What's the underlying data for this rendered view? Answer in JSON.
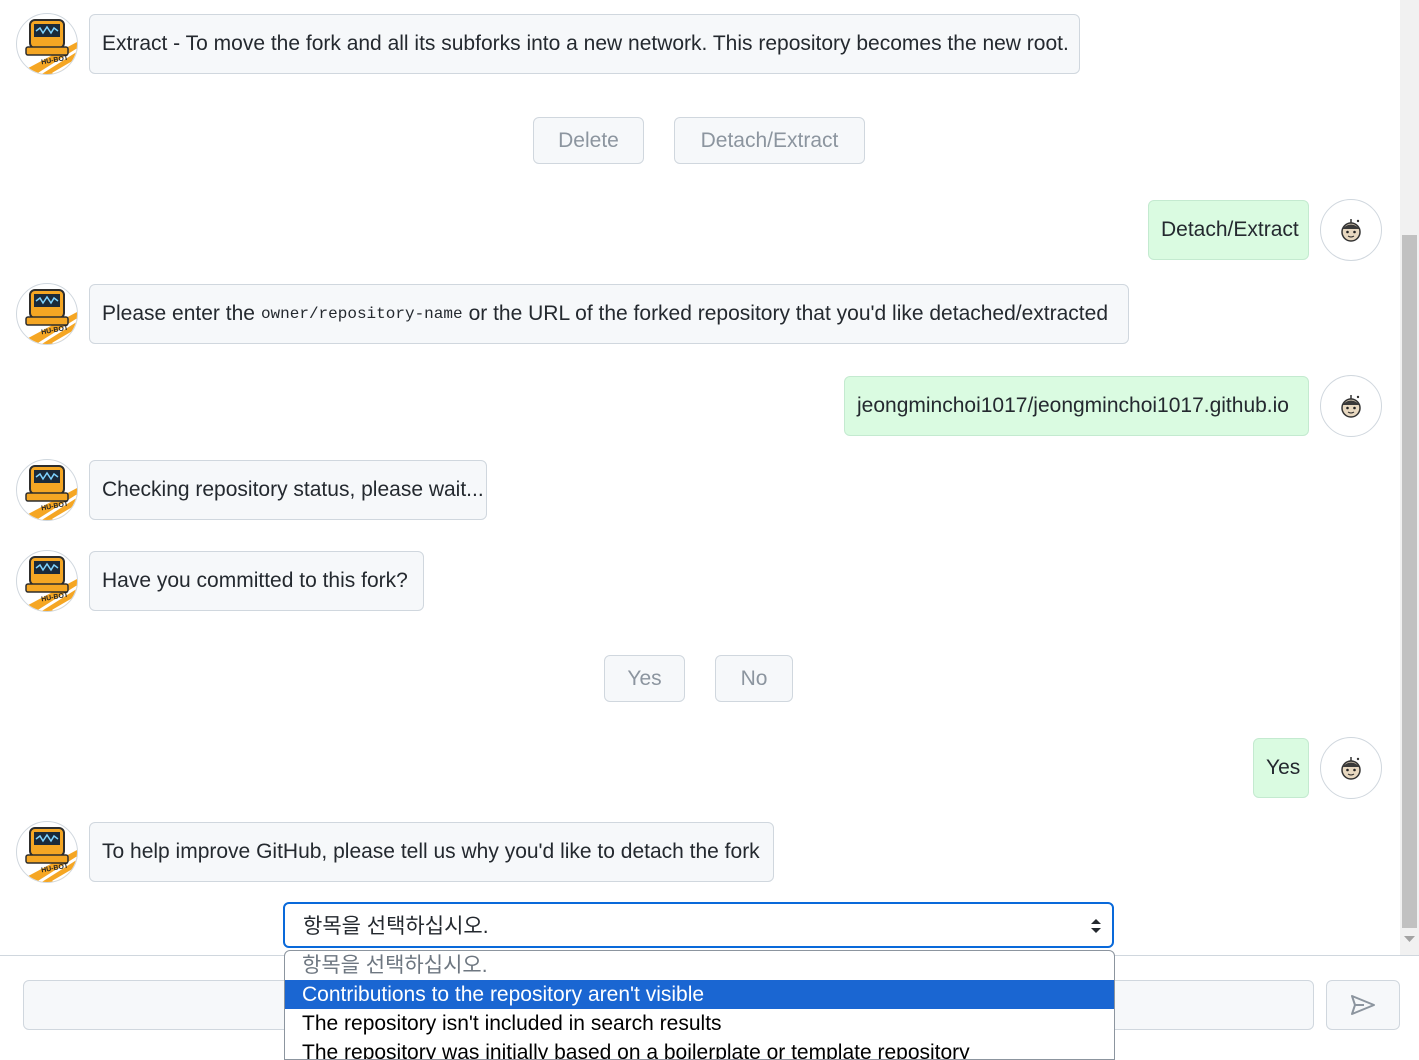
{
  "chat": {
    "messages": [
      {
        "text": "Extract - To move the fork and all its subforks into a new network. This repository becomes the new root."
      },
      {
        "text_before": "Please enter the",
        "code": "owner/repository-name",
        "text_after": "or the URL of the forked repository that you'd like detached/extracted"
      },
      {
        "text": "Checking repository status, please wait..."
      },
      {
        "text": "Have you committed to this fork?"
      },
      {
        "text": "To help improve GitHub, please tell us why you'd like to detach the fork"
      }
    ],
    "user_messages": [
      "Detach/Extract",
      "jeongminchoi1017/jeongminchoi1017.github.io",
      "Yes"
    ],
    "choices_1": [
      "Delete",
      "Detach/Extract"
    ],
    "choices_2": [
      "Yes",
      "No"
    ],
    "bot_label": "HU-BOT"
  },
  "reason_select": {
    "value": "항목을 선택하십시오.",
    "options": [
      "항목을 선택하십시오.",
      "Contributions to the repository aren't visible",
      "The repository isn't included in search results",
      "The repository was initially based on a boilerplate or template repository"
    ],
    "highlighted_index": 1
  },
  "colors": {
    "accent": "#0969da",
    "highlight": "#1a66d2",
    "user_bubble": "#dafbe1",
    "bot_bubble": "#f6f8fa",
    "robot_orange": "#f5a623"
  }
}
